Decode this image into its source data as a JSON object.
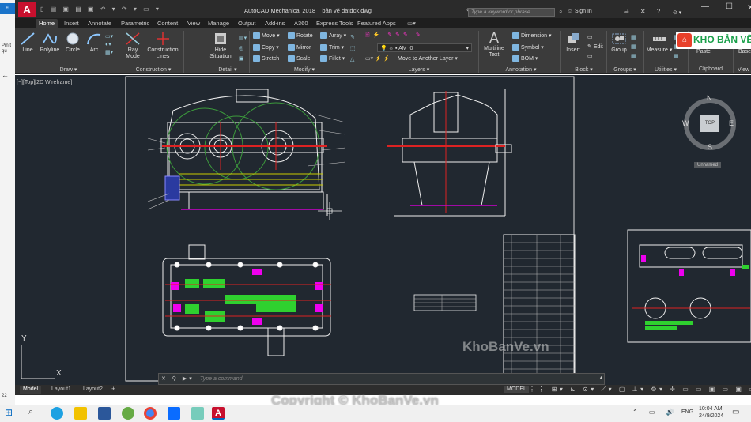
{
  "app": {
    "title": "AutoCAD Mechanical 2018",
    "file": "bản vẽ datdck.dwg",
    "logo": "A",
    "search_placeholder": "Type a keyword or phrase",
    "sign_in": "Sign In"
  },
  "tabs": [
    "Home",
    "Insert",
    "Annotate",
    "Parametric",
    "Content",
    "View",
    "Manage",
    "Output",
    "Add-ins",
    "A360",
    "Express Tools",
    "Featured Apps"
  ],
  "ribbon": {
    "draw": {
      "line": "Line",
      "polyline": "Polyline",
      "circle": "Circle",
      "arc": "Arc",
      "ray": "Ray Mode",
      "construction": "Construction Lines",
      "panel": "Draw"
    },
    "detail": {
      "hide": "Hide Situation",
      "panel": "Detail"
    },
    "modify": {
      "move": "Move",
      "rotate": "Rotate",
      "array": "Array",
      "copy": "Copy",
      "mirror": "Mirror",
      "trim": "Trim",
      "stretch": "Stretch",
      "scale": "Scale",
      "fillet": "Fillet",
      "panel": "Modify"
    },
    "layers": {
      "current": "AM_0",
      "move_to": "Move to Another Layer",
      "panel": "Layers"
    },
    "annotation": {
      "mtext": "Multiline Text",
      "dimension": "Dimension",
      "symbol": "Symbol",
      "bom": "BOM",
      "panel": "Annotation"
    },
    "block": {
      "insert": "Insert",
      "edit": "Edit",
      "panel": "Block"
    },
    "groups": {
      "group": "Group",
      "panel": "Groups"
    },
    "utilities": {
      "measure": "Measure",
      "panel": "Utilities"
    },
    "clipboard": {
      "paste": "Paste",
      "panel": "Clipboard"
    },
    "view": {
      "base": "Base",
      "panel": "View"
    }
  },
  "viewport": {
    "label": "[−][Top][2D Wireframe]",
    "unnamed": "Unnamed",
    "y_axis": "Y",
    "x_axis": "X"
  },
  "viewcube": {
    "top": "TOP",
    "n": "N",
    "s": "S",
    "e": "E",
    "w": "W"
  },
  "watermark_brand": "KHO BẢN VẼ",
  "watermark_center": "KhoBanVe.vn",
  "copyright": "Copyright © KhoBanVe.vn",
  "command_placeholder": "Type a command",
  "layout_tabs": [
    "Model",
    "Layout1",
    "Layout2"
  ],
  "status": {
    "model": "MODEL"
  },
  "left_strip": [
    "Fi",
    "Pin t",
    "qu",
    "22"
  ],
  "taskbar": {
    "lang": "ENG",
    "time": "10:04 AM",
    "date": "24/9/2024"
  },
  "colors": {
    "canvas": "#212830",
    "ribbon": "#3b3b3b",
    "accent": "#c8102e"
  }
}
